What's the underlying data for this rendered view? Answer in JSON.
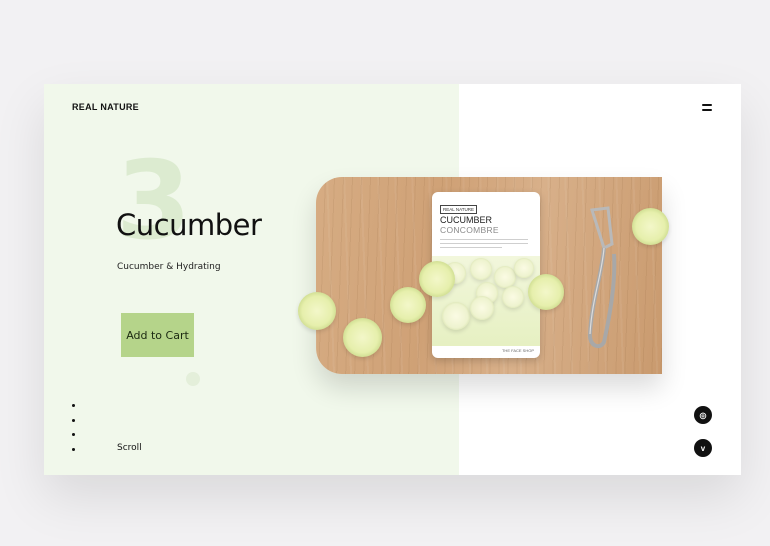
{
  "brand": {
    "name": "REAL NATURE"
  },
  "hero": {
    "number": "3",
    "title": "Cucumber",
    "subtitle": "Cucumber & Hydrating",
    "cta_label": "Add to Cart",
    "scroll_label": "Scroll"
  },
  "pagination": {
    "count": 4
  },
  "social": [
    {
      "icon": "instagram-icon",
      "glyph": "◎"
    },
    {
      "icon": "vimeo-icon",
      "glyph": "v"
    }
  ],
  "product": {
    "brand_tag": "REAL NATURE",
    "name": "CUCUMBER",
    "name_fr": "CONCOMBRE",
    "maker": "THE FACE SHOP"
  },
  "colors": {
    "accent_green": "#b5d48a",
    "panel_green": "#f1f8eb",
    "text_dark": "#111111"
  }
}
